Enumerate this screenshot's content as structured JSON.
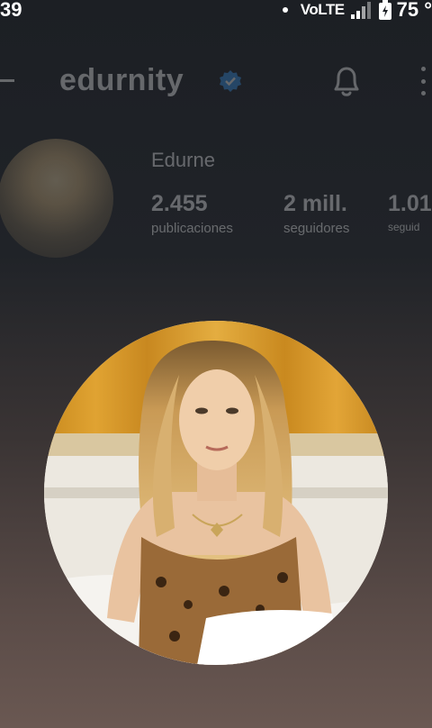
{
  "status_bar": {
    "time": "39",
    "network": "VoLTE",
    "battery": "75 °"
  },
  "profile": {
    "username": "edurnity",
    "full_name": "Edurne",
    "stats": [
      {
        "value": "2.455",
        "label": "publicaciones"
      },
      {
        "value": "2 mill.",
        "label": "seguidores"
      },
      {
        "value": "1.01",
        "label": "seguid"
      }
    ]
  },
  "colors": {
    "background_top": "#1c1f24",
    "background_bottom": "#6a5852",
    "verified_badge": "#3897f0"
  },
  "icons": [
    "back-arrow-icon",
    "verified-badge-icon",
    "bell-icon",
    "more-options-icon"
  ]
}
